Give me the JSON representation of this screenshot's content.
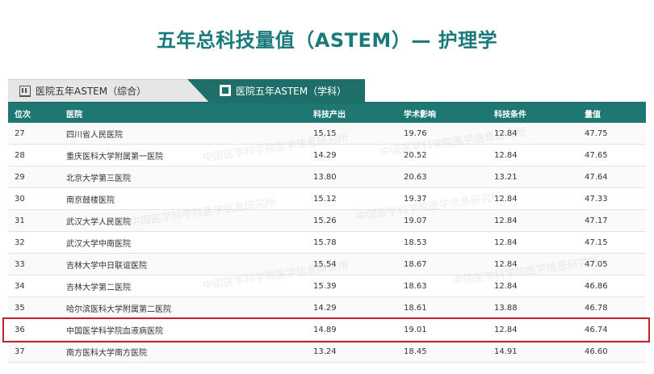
{
  "title": "五年总科技量值（ASTEM）— 护理学",
  "tabs": [
    {
      "label": "医院五年ASTEM（综合）",
      "icon": "building-icon",
      "active": false
    },
    {
      "label": "医院五年ASTEM（学科）",
      "icon": "book-icon",
      "active": true
    }
  ],
  "table": {
    "headers": {
      "rank": "位次",
      "hospital": "医院",
      "output": "科技产出",
      "influence": "学术影响",
      "conditions": "科技条件",
      "value": "量值"
    },
    "rows": [
      {
        "rank": "27",
        "hospital": "四川省人民医院",
        "output": "15.15",
        "influence": "19.76",
        "conditions": "12.84",
        "value": "47.75"
      },
      {
        "rank": "28",
        "hospital": "重庆医科大学附属第一医院",
        "output": "14.29",
        "influence": "20.52",
        "conditions": "12.84",
        "value": "47.65"
      },
      {
        "rank": "29",
        "hospital": "北京大学第三医院",
        "output": "13.80",
        "influence": "20.63",
        "conditions": "13.21",
        "value": "47.64"
      },
      {
        "rank": "30",
        "hospital": "南京鼓楼医院",
        "output": "15.12",
        "influence": "19.37",
        "conditions": "12.84",
        "value": "47.33"
      },
      {
        "rank": "31",
        "hospital": "武汉大学人民医院",
        "output": "15.26",
        "influence": "19.07",
        "conditions": "12.84",
        "value": "47.17"
      },
      {
        "rank": "32",
        "hospital": "武汉大学中南医院",
        "output": "15.78",
        "influence": "18.53",
        "conditions": "12.84",
        "value": "47.15"
      },
      {
        "rank": "33",
        "hospital": "吉林大学中日联谊医院",
        "output": "15.54",
        "influence": "18.67",
        "conditions": "12.84",
        "value": "47.05"
      },
      {
        "rank": "34",
        "hospital": "吉林大学第二医院",
        "output": "15.39",
        "influence": "18.63",
        "conditions": "12.84",
        "value": "46.86"
      },
      {
        "rank": "35",
        "hospital": "哈尔滨医科大学附属第二医院",
        "output": "14.29",
        "influence": "18.61",
        "conditions": "13.88",
        "value": "46.78"
      },
      {
        "rank": "36",
        "hospital": "中国医学科学院血液病医院",
        "output": "14.89",
        "influence": "19.01",
        "conditions": "12.84",
        "value": "46.74"
      },
      {
        "rank": "37",
        "hospital": "南方医科大学南方医院",
        "output": "13.24",
        "influence": "18.45",
        "conditions": "14.91",
        "value": "46.60"
      }
    ],
    "highlighted_rank": "36"
  },
  "watermark": "中国医学科学院医学信息研究所",
  "colors": {
    "title": "#1a7a7a",
    "header_bg": "#1f7774",
    "highlight": "#c0242b"
  }
}
